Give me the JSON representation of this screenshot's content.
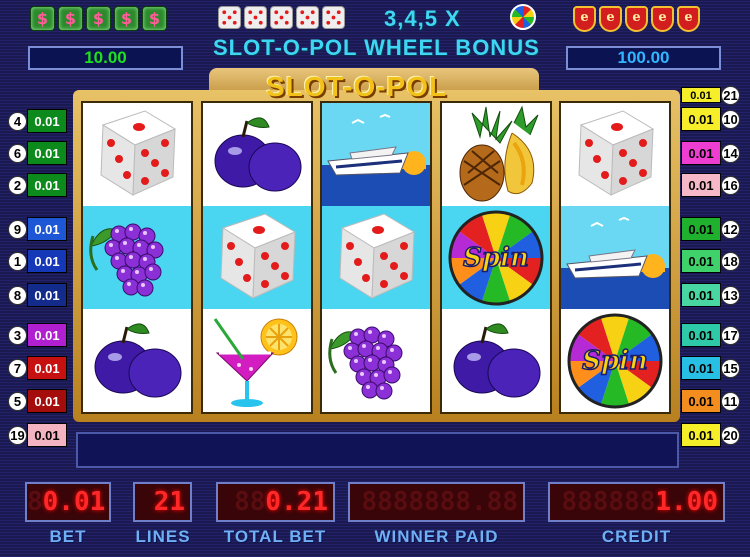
{
  "header": {
    "left_value": "10.00",
    "right_value": "100.00",
    "title_top": "3,4,5 X",
    "title_bottom": "SLOT-O-POL  WHEEL BONUS",
    "left_icons": [
      "dollar-icon",
      "dollar-icon",
      "dollar-icon",
      "dollar-icon",
      "dollar-icon"
    ],
    "center_icons": [
      "die-icon",
      "die-icon",
      "die-icon",
      "die-icon",
      "die-icon"
    ],
    "right_icons": [
      "badge-icon",
      "badge-icon",
      "badge-icon",
      "badge-icon",
      "badge-icon"
    ],
    "dollar_glyph": "$",
    "badge_glyph": "e"
  },
  "banner": {
    "title": "SLOT-O-POL"
  },
  "reels": [
    [
      "dice",
      "grapes",
      "plums"
    ],
    [
      "plums",
      "dice",
      "cocktail"
    ],
    [
      "ship",
      "dice",
      "grapes"
    ],
    [
      "pineapple",
      "spin-wheel",
      "plums"
    ],
    [
      "dice",
      "ship",
      "spin-wheel"
    ]
  ],
  "spin_text": "Spin",
  "left_lines": [
    {
      "num": "4",
      "bet": "0.01",
      "color": "#0d8a1c"
    },
    {
      "num": "6",
      "bet": "0.01",
      "color": "#0d8a1c"
    },
    {
      "num": "2",
      "bet": "0.01",
      "color": "#0d8a1c"
    },
    {
      "num": "9",
      "bet": "0.01",
      "color": "#1d57d6"
    },
    {
      "num": "1",
      "bet": "0.01",
      "color": "#1438b8"
    },
    {
      "num": "8",
      "bet": "0.01",
      "color": "#132c8c"
    },
    {
      "num": "3",
      "bet": "0.01",
      "color": "#b01fd0"
    },
    {
      "num": "7",
      "bet": "0.01",
      "color": "#c71010"
    },
    {
      "num": "5",
      "bet": "0.01",
      "color": "#a50c0c"
    },
    {
      "num": "19",
      "bet": "0.01",
      "color": "#f3b3c1"
    }
  ],
  "right_lines": [
    {
      "num": "21",
      "bet": "0.01",
      "color": "#f7ee2a"
    },
    {
      "num": "10",
      "bet": "0.01",
      "color": "#f7ee2a"
    },
    {
      "num": "14",
      "bet": "0.01",
      "color": "#ee3ed2"
    },
    {
      "num": "16",
      "bet": "0.01",
      "color": "#f6b7c8"
    },
    {
      "num": "12",
      "bet": "0.01",
      "color": "#1fb02e"
    },
    {
      "num": "18",
      "bet": "0.01",
      "color": "#40d26a"
    },
    {
      "num": "13",
      "bet": "0.01",
      "color": "#48d6a2"
    },
    {
      "num": "17",
      "bet": "0.01",
      "color": "#2ec9a8"
    },
    {
      "num": "15",
      "bet": "0.01",
      "color": "#28bfe4"
    },
    {
      "num": "11",
      "bet": "0.01",
      "color": "#f28d1e"
    },
    {
      "num": "20",
      "bet": "0.01",
      "color": "#f7ee2a"
    }
  ],
  "message": "",
  "displays": {
    "bet": {
      "label": "BET",
      "value": "0.01"
    },
    "lines": {
      "label": "LINES",
      "value": "21"
    },
    "total_bet": {
      "label": "TOTAL BET",
      "value": "0.21"
    },
    "winner_paid": {
      "label": "WINNER  PAID",
      "value": ""
    },
    "credit": {
      "label": "CREDIT",
      "value": "1.00"
    }
  },
  "colors": {
    "left_value": "#1ee01e",
    "right_value": "#2fb6ff",
    "digit": "#ff2828"
  }
}
